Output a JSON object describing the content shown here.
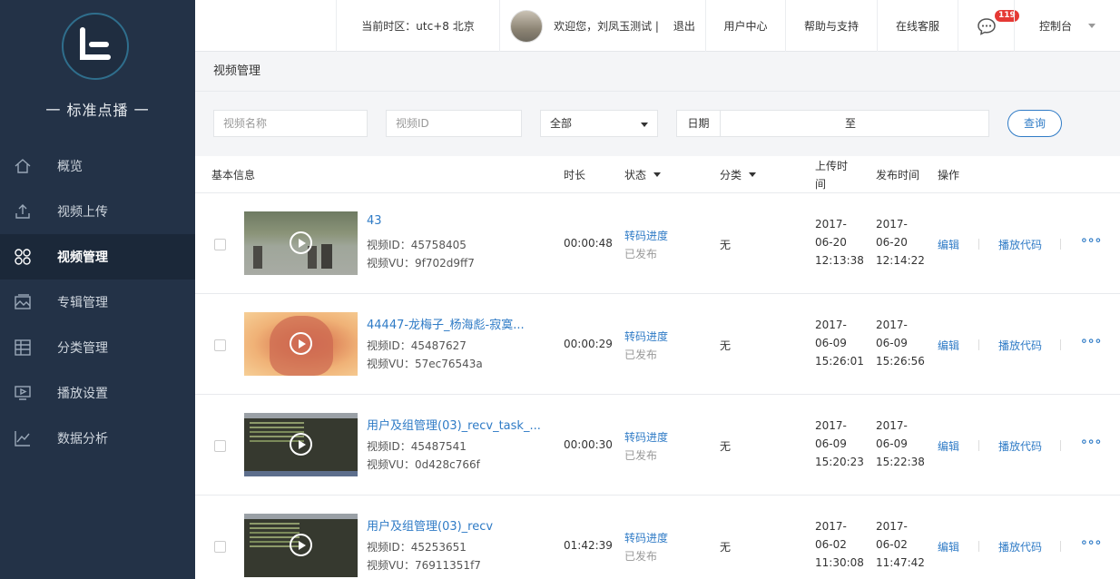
{
  "sidebar": {
    "brand": "一 标准点播 一",
    "items": [
      {
        "label": "概览",
        "icon": "home-icon"
      },
      {
        "label": "视频上传",
        "icon": "upload-icon"
      },
      {
        "label": "视频管理",
        "icon": "grid-circles-icon",
        "active": true
      },
      {
        "label": "专辑管理",
        "icon": "album-icon"
      },
      {
        "label": "分类管理",
        "icon": "table-icon"
      },
      {
        "label": "播放设置",
        "icon": "monitor-play-icon"
      },
      {
        "label": "数据分析",
        "icon": "chart-line-icon"
      }
    ]
  },
  "topbar": {
    "timezone": "当前时区：utc+8 北京",
    "welcome": "欢迎您，刘凤玉测试  |",
    "logout": "退出",
    "user_center": "用户中心",
    "help": "帮助与支持",
    "service": "在线客服",
    "message_count": "119",
    "console": "控制台"
  },
  "page": {
    "title": "视频管理"
  },
  "filters": {
    "name_placeholder": "视频名称",
    "id_placeholder": "视频ID",
    "status_select": "全部",
    "date_label": "日期",
    "date_sep": "至",
    "query": "查询"
  },
  "table": {
    "headers": {
      "basic": "基本信息",
      "duration": "时长",
      "status": "状态",
      "category": "分类",
      "upload_time": "上传时间",
      "publish_time": "发布时间",
      "ops": "操作"
    },
    "rows": [
      {
        "title": "43",
        "vid": "视频ID：45758405",
        "vu": "视频VU：9f702d9ff7",
        "duration": "00:00:48",
        "status": "转码进度",
        "status_sub": "已发布",
        "category": "无",
        "up_y": "2017-",
        "up_d": "06-20",
        "up_t": "12:13:38",
        "pub_y": "2017-",
        "pub_d": "06-20",
        "pub_t": "12:14:22",
        "edit": "编辑",
        "code": "播放代码",
        "more": "∘∘∘"
      },
      {
        "title": "44447-龙梅子_杨海彪-寂寞...",
        "vid": "视频ID：45487627",
        "vu": "视频VU：57ec76543a",
        "duration": "00:00:29",
        "status": "转码进度",
        "status_sub": "已发布",
        "category": "无",
        "up_y": "2017-",
        "up_d": "06-09",
        "up_t": "15:26:01",
        "pub_y": "2017-",
        "pub_d": "06-09",
        "pub_t": "15:26:56",
        "edit": "编辑",
        "code": "播放代码",
        "more": "∘∘∘"
      },
      {
        "title": "用户及组管理(03)_recv_task_...",
        "vid": "视频ID：45487541",
        "vu": "视频VU：0d428c766f",
        "duration": "00:00:30",
        "status": "转码进度",
        "status_sub": "已发布",
        "category": "无",
        "up_y": "2017-",
        "up_d": "06-09",
        "up_t": "15:20:23",
        "pub_y": "2017-",
        "pub_d": "06-09",
        "pub_t": "15:22:38",
        "edit": "编辑",
        "code": "播放代码",
        "more": "∘∘∘"
      },
      {
        "title": "用户及组管理(03)_recv",
        "vid": "视频ID：45253651",
        "vu": "视频VU：76911351f7",
        "duration": "01:42:39",
        "status": "转码进度",
        "status_sub": "已发布",
        "category": "无",
        "up_y": "2017-",
        "up_d": "06-02",
        "up_t": "11:30:08",
        "pub_y": "2017-",
        "pub_d": "06-02",
        "pub_t": "11:47:42",
        "edit": "编辑",
        "code": "播放代码",
        "more": "∘∘∘"
      }
    ]
  }
}
